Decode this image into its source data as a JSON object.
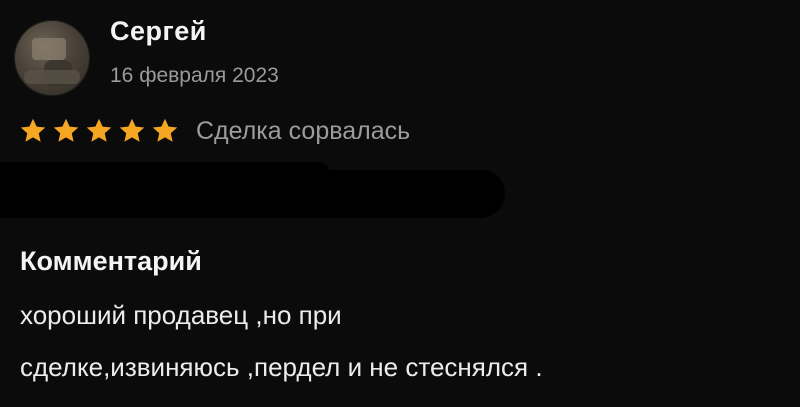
{
  "review": {
    "author": "Сергей",
    "date": "16 февраля 2023",
    "rating": 5,
    "rating_max": 5,
    "star_color": "#f5a623",
    "status": "Сделка сорвалась",
    "comment_heading": "Комментарий",
    "comment_lines": [
      "хороший продавец ,но при",
      "сделке,извиняюсь ,пердел и не стеснялся ."
    ]
  }
}
